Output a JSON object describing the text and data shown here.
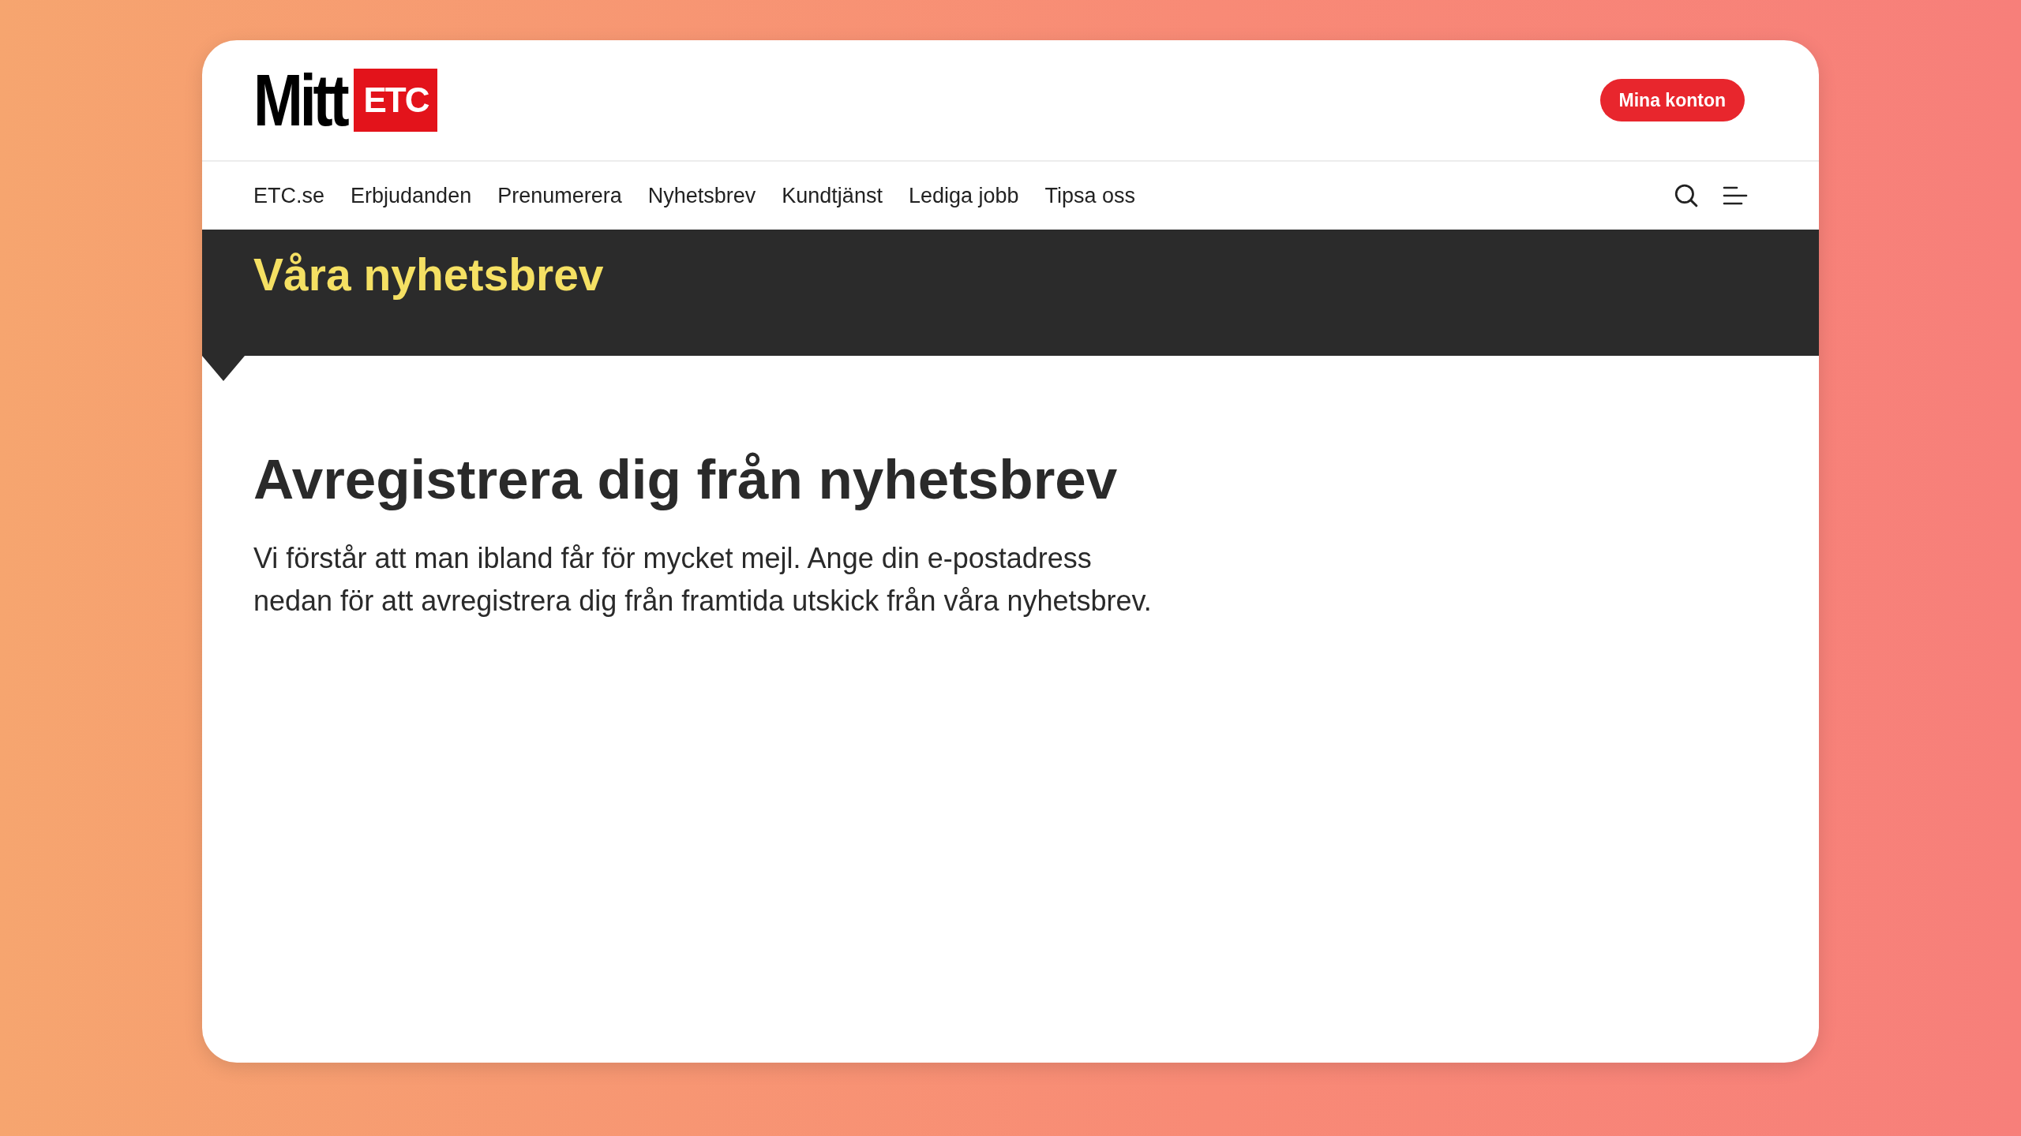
{
  "logo": {
    "word": "Mitt",
    "badge": "ETC"
  },
  "account_button": "Mina konton",
  "nav": [
    {
      "label": "ETC.se"
    },
    {
      "label": "Erbjudanden"
    },
    {
      "label": "Prenumerera"
    },
    {
      "label": "Nyhetsbrev"
    },
    {
      "label": "Kundtjänst"
    },
    {
      "label": "Lediga jobb"
    },
    {
      "label": "Tipsa oss"
    }
  ],
  "banner": {
    "title": "Våra nyhetsbrev"
  },
  "content": {
    "heading": "Avregistrera dig från nyhetsbrev",
    "text": "Vi förstår att man ibland får för mycket mejl. Ange din e-postadress nedan för att avregistrera dig från framtida utskick från våra nyhetsbrev."
  }
}
